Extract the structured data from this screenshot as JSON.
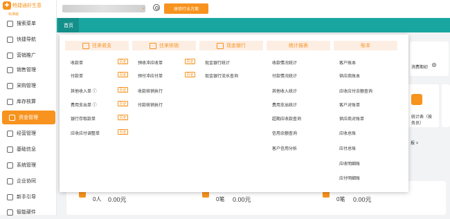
{
  "app": {
    "logo_name": "畅捷通好生意",
    "logo_sub": "标准版",
    "trial_button": "体验行业方案"
  },
  "sidebar": {
    "items": [
      {
        "label": "搜索菜单",
        "icon": "search-icon"
      },
      {
        "label": "快捷导航",
        "icon": "navigation-icon"
      },
      {
        "label": "营销推广",
        "icon": "marketing-icon"
      },
      {
        "label": "销售管理",
        "icon": "sales-icon"
      },
      {
        "label": "采购管理",
        "icon": "purchase-icon"
      },
      {
        "label": "库存核算",
        "icon": "inventory-icon"
      },
      {
        "label": "资金管理",
        "icon": "money-icon",
        "active": true
      },
      {
        "label": "经营管理",
        "icon": "business-icon"
      },
      {
        "label": "基础信息",
        "icon": "info-icon"
      },
      {
        "label": "系统管理",
        "icon": "settings-icon"
      },
      {
        "label": "企业协同",
        "icon": "collaboration-icon"
      },
      {
        "label": "新手引导",
        "icon": "guide-icon"
      },
      {
        "label": "智能硬件",
        "icon": "hardware-icon"
      }
    ]
  },
  "tabs": {
    "home": "首页"
  },
  "background": {
    "date_label": "消费期初",
    "stat_card_title": "统计表（按",
    "stat_card_sub": "务员）",
    "report_link": "报 >"
  },
  "stats": [
    {
      "count": "0人",
      "amount": "0.00元"
    },
    {
      "count": "0笔",
      "amount": "0.00元"
    },
    {
      "count": "0笔",
      "amount": "0.00元"
    }
  ],
  "menu": {
    "history_label": "历史",
    "columns": [
      {
        "title": "往来收支",
        "icon": "money-flow-icon",
        "items": [
          {
            "label": "收款单",
            "history": true
          },
          {
            "label": "付款单",
            "history": true
          },
          {
            "label": "其他收入单 ⓘ",
            "history": true
          },
          {
            "label": "费用支出单 ⓘ",
            "history": true
          },
          {
            "label": "银行存取款单",
            "history": true
          },
          {
            "label": "应收应付调整单",
            "history": true
          }
        ]
      },
      {
        "title": "往来核销",
        "icon": "writeoff-icon",
        "items": [
          {
            "label": "预收冲应收单",
            "history": true
          },
          {
            "label": "预付冲应付单",
            "history": true
          },
          {
            "label": "收款核销执行",
            "history": false
          },
          {
            "label": "付款核销执行",
            "history": false
          }
        ]
      },
      {
        "title": "现金银行",
        "icon": "bank-icon",
        "items": [
          {
            "label": "现金银行统计",
            "history": false
          },
          {
            "label": "现金银行流水查询",
            "history": false
          }
        ]
      },
      {
        "title": "统计报表",
        "icon": "",
        "items": [
          {
            "label": "收款情况统计",
            "history": false
          },
          {
            "label": "付款情况统计",
            "history": false
          },
          {
            "label": "其他收入统计",
            "history": false
          },
          {
            "label": "费用支出统计",
            "history": false
          },
          {
            "label": "超期应收款查询",
            "history": false
          },
          {
            "label": "信用余额查询",
            "history": false
          },
          {
            "label": "客户信用分析",
            "history": false
          }
        ]
      },
      {
        "title": "账本",
        "icon": "",
        "items": [
          {
            "label": "客户账本",
            "history": false
          },
          {
            "label": "供应商账本",
            "history": false
          },
          {
            "label": "应收应付余额查询",
            "history": false
          },
          {
            "label": "客户对账单",
            "history": false
          },
          {
            "label": "供应商对账单",
            "history": false
          },
          {
            "label": "应收总账",
            "history": false
          },
          {
            "label": "应付总账",
            "history": false
          },
          {
            "label": "应收明细账",
            "history": false
          },
          {
            "label": "应付明细账",
            "history": false
          }
        ]
      }
    ]
  },
  "colors": {
    "accent": "#f7931e",
    "teal": "#1aa6a0"
  }
}
